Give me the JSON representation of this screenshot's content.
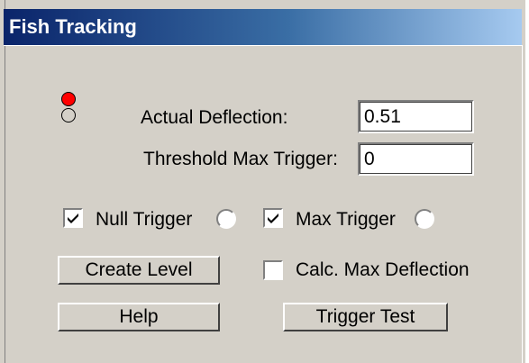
{
  "window": {
    "title": "Fish Tracking"
  },
  "indicators": {
    "top": {
      "state": "on",
      "color": "#ff0000"
    },
    "bottom": {
      "state": "off",
      "color": "#d4d0c8"
    }
  },
  "fields": {
    "actual_deflection": {
      "label": "Actual Deflection:",
      "value": "0.51"
    },
    "threshold_max_trigger": {
      "label": "Threshold Max Trigger:",
      "value": "0"
    }
  },
  "options": {
    "null_trigger": {
      "label": "Null Trigger",
      "checked": true
    },
    "max_trigger": {
      "label": "Max Trigger",
      "checked": true
    },
    "calc_max_deflection": {
      "label": "Calc. Max Deflection",
      "checked": false
    }
  },
  "buttons": {
    "create_level": "Create Level",
    "help": "Help",
    "trigger_test": "Trigger Test"
  },
  "colors": {
    "face": "#d4d0c8",
    "title_start": "#0a246a",
    "title_end": "#a6caf0",
    "led_on": "#ff0000"
  }
}
